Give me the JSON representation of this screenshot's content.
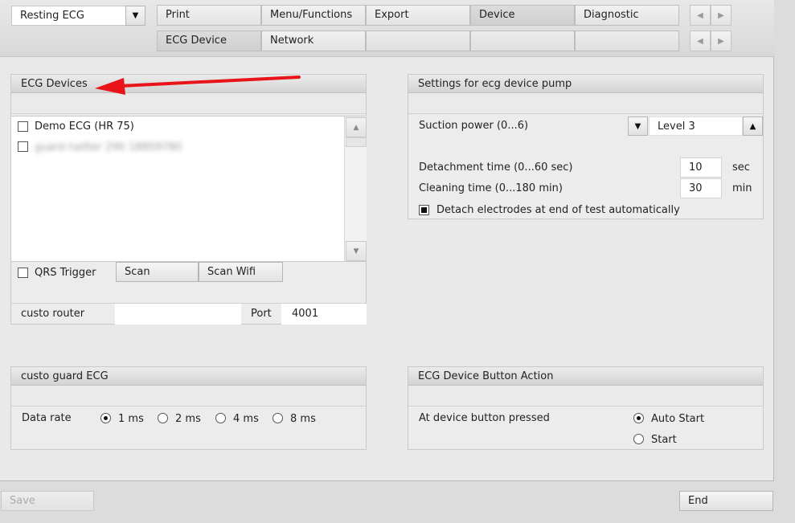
{
  "header": {
    "mode_select": "Resting ECG",
    "tabs_row1": [
      "Print",
      "Menu/Functions",
      "Export",
      "Device",
      "Diagnostic"
    ],
    "tabs_row2": [
      "ECG Device",
      "Network",
      "",
      "",
      ""
    ],
    "prev_icon": "chevron-left-icon",
    "next_icon": "chevron-right-icon"
  },
  "ecg_devices": {
    "title": "ECG Devices",
    "devices": [
      {
        "label": "Demo ECG (HR 75)",
        "checked": false
      },
      {
        "label": "guard hallter 290 18859780",
        "checked": false
      }
    ],
    "qrs_trigger_label": "QRS Trigger",
    "scan_label": "Scan",
    "scan_wifi_label": "Scan Wifi",
    "router_label": "custo router",
    "router_value": "",
    "port_label": "Port",
    "port_value": "4001"
  },
  "pump": {
    "title": "Settings for ecg device pump",
    "suction_label": "Suction power (0...6)",
    "suction_value": "Level 3",
    "detachment_label": "Detachment time (0...60 sec)",
    "detachment_value": "10",
    "detachment_unit": "sec",
    "cleaning_label": "Cleaning time (0...180 min)",
    "cleaning_value": "30",
    "cleaning_unit": "min",
    "detach_auto_label": "Detach electrodes at end of test automatically",
    "detach_auto_checked": true
  },
  "guard": {
    "title": "custo guard ECG",
    "data_rate_label": "Data rate",
    "rates": [
      "1 ms",
      "2 ms",
      "4 ms",
      "8 ms"
    ],
    "selected": "1 ms"
  },
  "button_action": {
    "title": "ECG Device Button Action",
    "prompt": "At device button pressed",
    "options": [
      "Auto Start",
      "Start"
    ],
    "selected": "Auto Start"
  },
  "footer": {
    "save_label": "Save",
    "end_label": "End"
  },
  "annotation": {
    "arrow_color": "#e8141a"
  }
}
